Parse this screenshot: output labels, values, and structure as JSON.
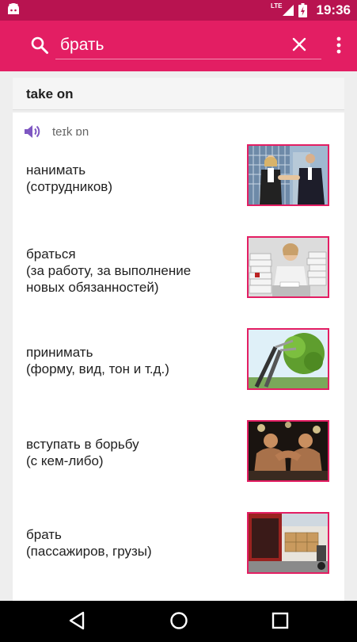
{
  "status_bar": {
    "network_label": "LTE",
    "time": "19:36"
  },
  "search": {
    "query": "брать"
  },
  "entry": {
    "phrase": "take on",
    "transcription": "teɪk ɒn",
    "meanings": [
      {
        "line1": "нанимать",
        "line2": "(сотрудников)",
        "line3": ""
      },
      {
        "line1": "браться",
        "line2": "(за работу, за выполнение",
        "line3": "новых обязанностей)"
      },
      {
        "line1": "принимать",
        "line2": "(форму, вид, тон и т.д.)",
        "line3": ""
      },
      {
        "line1": "вступать в борьбу",
        "line2": "(с кем-либо)",
        "line3": ""
      },
      {
        "line1": "брать",
        "line2": "(пассажиров, грузы)",
        "line3": ""
      }
    ]
  },
  "colors": {
    "primary": "#e31e63",
    "primary_dark": "#b81350",
    "speaker": "#7e57c2"
  },
  "icons": {
    "status_left": "android-icon",
    "search": "search-icon",
    "clear": "close-icon",
    "menu": "more-vert-icon",
    "audio": "speaker-icon",
    "nav": [
      "back-icon",
      "home-icon",
      "recents-icon"
    ]
  }
}
